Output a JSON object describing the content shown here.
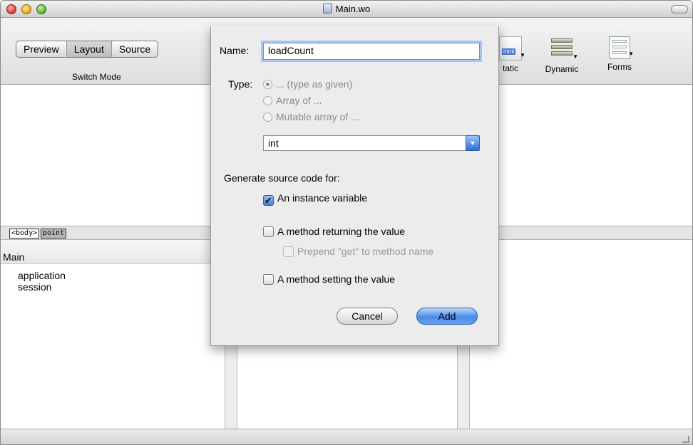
{
  "window": {
    "title": "Main.wo"
  },
  "toolbar": {
    "modes": [
      "Preview",
      "Layout",
      "Source"
    ],
    "switch_label": "Switch Mode",
    "items": [
      {
        "label": "Static",
        "visible_label": "tatic",
        "icon": "html-file-icon",
        "badge": "html"
      },
      {
        "label": "Dynamic",
        "icon": "dynamic-elements-icon"
      },
      {
        "label": "Forms",
        "icon": "forms-icon"
      }
    ]
  },
  "pathbar": {
    "body_tag": "<body>",
    "point_tag": "point"
  },
  "browser": {
    "header": "Main",
    "items": [
      "application",
      "session"
    ]
  },
  "sheet": {
    "name_label": "Name:",
    "name_value": "loadCount",
    "type_label": "Type:",
    "type_options": [
      {
        "label": "... (type as given)",
        "selected": true
      },
      {
        "label": "Array of ...",
        "selected": false
      },
      {
        "label": "Mutable array of ...",
        "selected": false
      }
    ],
    "type_value": "int",
    "generate_label": "Generate source code for:",
    "instance_variable": {
      "label": "An instance variable",
      "checked": true
    },
    "method_returning": {
      "label": "A method returning the value",
      "checked": false
    },
    "prepend_get": {
      "label": "Prepend \"get\" to method name",
      "checked": false
    },
    "method_setting": {
      "label": "A method setting the value",
      "checked": false
    },
    "cancel_label": "Cancel",
    "add_label": "Add"
  }
}
